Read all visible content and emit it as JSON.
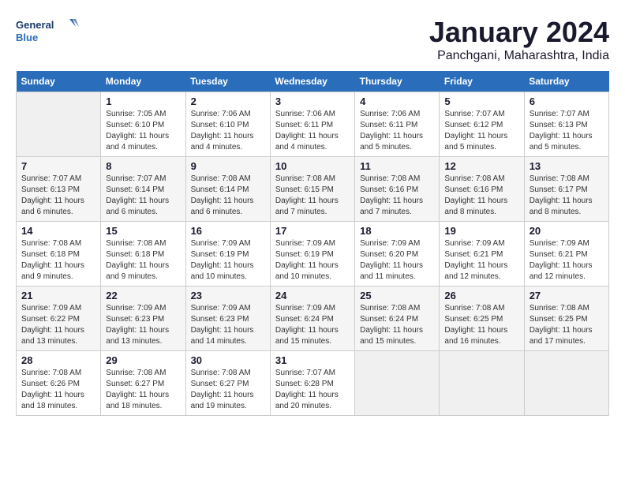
{
  "logo": {
    "line1": "General",
    "line2": "Blue"
  },
  "title": "January 2024",
  "subtitle": "Panchgani, Maharashtra, India",
  "days_header": [
    "Sunday",
    "Monday",
    "Tuesday",
    "Wednesday",
    "Thursday",
    "Friday",
    "Saturday"
  ],
  "weeks": [
    [
      {
        "num": "",
        "info": ""
      },
      {
        "num": "1",
        "info": "Sunrise: 7:05 AM\nSunset: 6:10 PM\nDaylight: 11 hours\nand 4 minutes."
      },
      {
        "num": "2",
        "info": "Sunrise: 7:06 AM\nSunset: 6:10 PM\nDaylight: 11 hours\nand 4 minutes."
      },
      {
        "num": "3",
        "info": "Sunrise: 7:06 AM\nSunset: 6:11 PM\nDaylight: 11 hours\nand 4 minutes."
      },
      {
        "num": "4",
        "info": "Sunrise: 7:06 AM\nSunset: 6:11 PM\nDaylight: 11 hours\nand 5 minutes."
      },
      {
        "num": "5",
        "info": "Sunrise: 7:07 AM\nSunset: 6:12 PM\nDaylight: 11 hours\nand 5 minutes."
      },
      {
        "num": "6",
        "info": "Sunrise: 7:07 AM\nSunset: 6:13 PM\nDaylight: 11 hours\nand 5 minutes."
      }
    ],
    [
      {
        "num": "7",
        "info": "Sunrise: 7:07 AM\nSunset: 6:13 PM\nDaylight: 11 hours\nand 6 minutes."
      },
      {
        "num": "8",
        "info": "Sunrise: 7:07 AM\nSunset: 6:14 PM\nDaylight: 11 hours\nand 6 minutes."
      },
      {
        "num": "9",
        "info": "Sunrise: 7:08 AM\nSunset: 6:14 PM\nDaylight: 11 hours\nand 6 minutes."
      },
      {
        "num": "10",
        "info": "Sunrise: 7:08 AM\nSunset: 6:15 PM\nDaylight: 11 hours\nand 7 minutes."
      },
      {
        "num": "11",
        "info": "Sunrise: 7:08 AM\nSunset: 6:16 PM\nDaylight: 11 hours\nand 7 minutes."
      },
      {
        "num": "12",
        "info": "Sunrise: 7:08 AM\nSunset: 6:16 PM\nDaylight: 11 hours\nand 8 minutes."
      },
      {
        "num": "13",
        "info": "Sunrise: 7:08 AM\nSunset: 6:17 PM\nDaylight: 11 hours\nand 8 minutes."
      }
    ],
    [
      {
        "num": "14",
        "info": "Sunrise: 7:08 AM\nSunset: 6:18 PM\nDaylight: 11 hours\nand 9 minutes."
      },
      {
        "num": "15",
        "info": "Sunrise: 7:08 AM\nSunset: 6:18 PM\nDaylight: 11 hours\nand 9 minutes."
      },
      {
        "num": "16",
        "info": "Sunrise: 7:09 AM\nSunset: 6:19 PM\nDaylight: 11 hours\nand 10 minutes."
      },
      {
        "num": "17",
        "info": "Sunrise: 7:09 AM\nSunset: 6:19 PM\nDaylight: 11 hours\nand 10 minutes."
      },
      {
        "num": "18",
        "info": "Sunrise: 7:09 AM\nSunset: 6:20 PM\nDaylight: 11 hours\nand 11 minutes."
      },
      {
        "num": "19",
        "info": "Sunrise: 7:09 AM\nSunset: 6:21 PM\nDaylight: 11 hours\nand 12 minutes."
      },
      {
        "num": "20",
        "info": "Sunrise: 7:09 AM\nSunset: 6:21 PM\nDaylight: 11 hours\nand 12 minutes."
      }
    ],
    [
      {
        "num": "21",
        "info": "Sunrise: 7:09 AM\nSunset: 6:22 PM\nDaylight: 11 hours\nand 13 minutes."
      },
      {
        "num": "22",
        "info": "Sunrise: 7:09 AM\nSunset: 6:23 PM\nDaylight: 11 hours\nand 13 minutes."
      },
      {
        "num": "23",
        "info": "Sunrise: 7:09 AM\nSunset: 6:23 PM\nDaylight: 11 hours\nand 14 minutes."
      },
      {
        "num": "24",
        "info": "Sunrise: 7:09 AM\nSunset: 6:24 PM\nDaylight: 11 hours\nand 15 minutes."
      },
      {
        "num": "25",
        "info": "Sunrise: 7:08 AM\nSunset: 6:24 PM\nDaylight: 11 hours\nand 15 minutes."
      },
      {
        "num": "26",
        "info": "Sunrise: 7:08 AM\nSunset: 6:25 PM\nDaylight: 11 hours\nand 16 minutes."
      },
      {
        "num": "27",
        "info": "Sunrise: 7:08 AM\nSunset: 6:25 PM\nDaylight: 11 hours\nand 17 minutes."
      }
    ],
    [
      {
        "num": "28",
        "info": "Sunrise: 7:08 AM\nSunset: 6:26 PM\nDaylight: 11 hours\nand 18 minutes."
      },
      {
        "num": "29",
        "info": "Sunrise: 7:08 AM\nSunset: 6:27 PM\nDaylight: 11 hours\nand 18 minutes."
      },
      {
        "num": "30",
        "info": "Sunrise: 7:08 AM\nSunset: 6:27 PM\nDaylight: 11 hours\nand 19 minutes."
      },
      {
        "num": "31",
        "info": "Sunrise: 7:07 AM\nSunset: 6:28 PM\nDaylight: 11 hours\nand 20 minutes."
      },
      {
        "num": "",
        "info": ""
      },
      {
        "num": "",
        "info": ""
      },
      {
        "num": "",
        "info": ""
      }
    ]
  ]
}
